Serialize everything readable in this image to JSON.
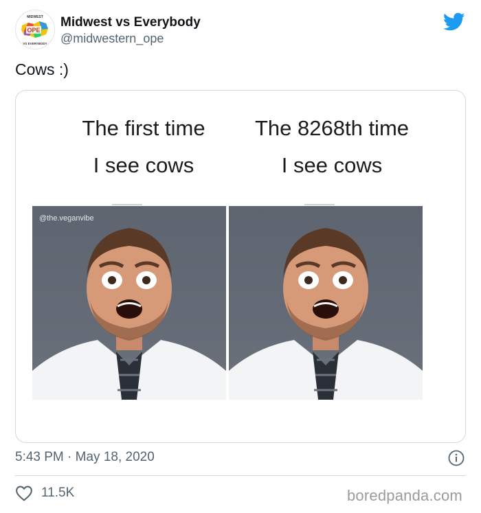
{
  "header": {
    "display_name": "Midwest vs Everybody",
    "handle": "@midwestern_ope",
    "avatar_text": {
      "top": "MIDWEST",
      "center": "OPE",
      "bottom": "VS EVERYBODY"
    },
    "logo_icon": "twitter-bird-icon",
    "brand_color": "#1d9bf0"
  },
  "tweet": {
    "text": "Cows :)"
  },
  "media": {
    "left_caption_line1": "The first time",
    "left_caption_line2": "I see cows",
    "right_caption_line1": "The 8268th time",
    "right_caption_line2": "I see cows",
    "watermark": "@the.veganvibe"
  },
  "footer": {
    "timestamp": "5:43 PM · May 18, 2020",
    "info_icon": "info-icon",
    "likes": "11.5K",
    "heart_icon": "heart-icon",
    "source": "boredpanda.com"
  }
}
